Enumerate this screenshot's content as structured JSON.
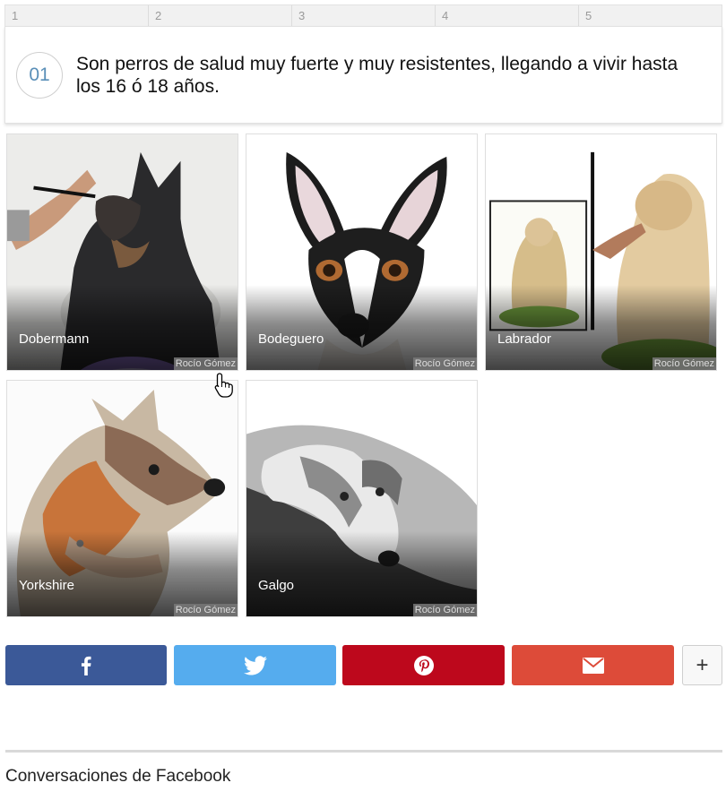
{
  "ruler": [
    "1",
    "2",
    "3",
    "4",
    "5"
  ],
  "fact": {
    "number": "01",
    "text": "Son perros de salud muy fuerte y muy resistentes, llegando a vivir hasta los 16 ó 18 años."
  },
  "gallery": [
    {
      "label": "Dobermann",
      "credit": "Rocío Gómez"
    },
    {
      "label": "Bodeguero",
      "credit": "Rocío Gómez"
    },
    {
      "label": "Labrador",
      "credit": "Rocío Gómez"
    },
    {
      "label": "Yorkshire",
      "credit": "Rocío Gómez"
    },
    {
      "label": "Galgo",
      "credit": "Rocío Gómez"
    }
  ],
  "share": {
    "facebook": {
      "icon": "facebook-icon",
      "color": "#3b5998"
    },
    "twitter": {
      "icon": "twitter-icon",
      "color": "#55acee"
    },
    "pinterest": {
      "icon": "pinterest-icon",
      "color": "#bd081c"
    },
    "email": {
      "icon": "mail-icon",
      "color": "#dd4b39"
    },
    "more_label": "+"
  },
  "comments_heading": "Conversaciones de Facebook"
}
